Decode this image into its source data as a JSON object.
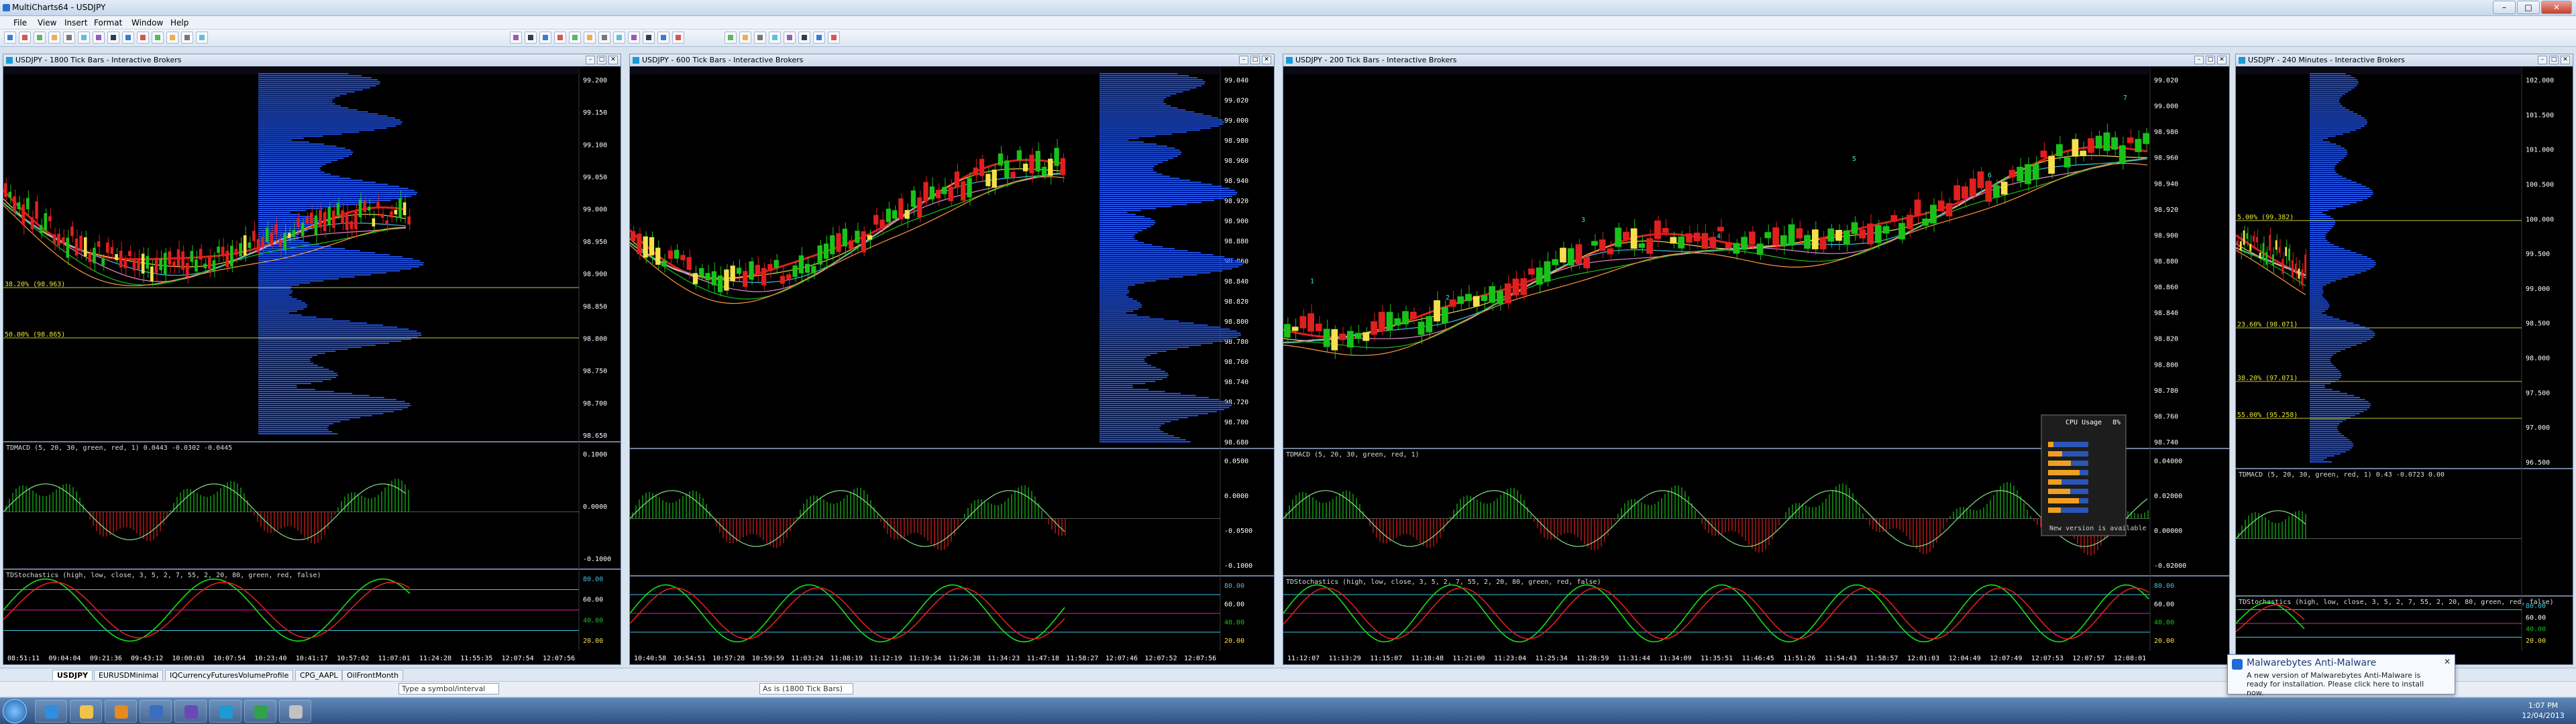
{
  "app": {
    "title": "MultiCharts64 - USDJPY",
    "menu": [
      "File",
      "View",
      "Insert",
      "Format",
      "Window",
      "Help"
    ]
  },
  "windows": [
    {
      "title": "USDJPY - 1800 Tick Bars - Interactive Brokers",
      "price_labels": [
        "99.200",
        "99.150",
        "99.100",
        "99.050",
        "99.000",
        "98.950",
        "98.900",
        "98.850",
        "98.800",
        "98.750",
        "98.700",
        "98.650"
      ],
      "fib_labels": [
        "38.20% (98.963)",
        "50.00% (98.865)"
      ],
      "macd_label": "TDMACD (5, 20, 30, green, red, 1)  0.0443 -0.0302 -0.0445",
      "macd_ticks": [
        "0.1000",
        "0.0000",
        "-0.1000"
      ],
      "stoch_label": "TDStochastics (high, low, close, 3, 5, 2, 7, 55, 2, 20, 80, green, red, false)",
      "stoch_ticks": [
        "80.00",
        "60.00",
        "40.00",
        "20.00"
      ],
      "time_labels": [
        "08:51:11",
        "09:04:04",
        "09:21:36",
        "09:43:12",
        "10:00:03",
        "10:07:54",
        "10:23:40",
        "10:41:17",
        "10:57:02",
        "11:07:01",
        "11:24:28",
        "11:55:35",
        "12:07:54",
        "12:07:56"
      ]
    },
    {
      "title": "USDJPY - 600 Tick Bars - Interactive Brokers",
      "price_labels": [
        "99.040",
        "99.020",
        "99.000",
        "98.980",
        "98.960",
        "98.940",
        "98.920",
        "98.900",
        "98.880",
        "98.860",
        "98.840",
        "98.820",
        "98.800",
        "98.780",
        "98.760",
        "98.740",
        "98.720",
        "98.700",
        "98.680"
      ],
      "macd_label": "",
      "macd_ticks": [
        "0.0500",
        "0.0000",
        "-0.0500",
        "-0.1000"
      ],
      "stoch_label": "",
      "stoch_ticks": [
        "80.00",
        "60.00",
        "40.00",
        "20.00"
      ],
      "time_labels": [
        "10:40:58",
        "10:54:51",
        "10:57:28",
        "10:59:59",
        "11:03:24",
        "11:08:19",
        "11:12:19",
        "11:19:34",
        "11:26:38",
        "11:34:23",
        "11:47:18",
        "11:58:27",
        "12:07:46",
        "12:07:52",
        "12:07:56"
      ]
    },
    {
      "title": "USDJPY - 200 Tick Bars - Interactive Brokers",
      "price_labels": [
        "99.020",
        "99.000",
        "98.980",
        "98.960",
        "98.940",
        "98.920",
        "98.900",
        "98.880",
        "98.860",
        "98.840",
        "98.820",
        "98.800",
        "98.780",
        "98.760",
        "98.740"
      ],
      "wave_labels": [
        "1",
        "2",
        "3",
        "4",
        "5",
        "6",
        "7"
      ],
      "macd_label": "TDMACD (5, 20, 30, green, red, 1)",
      "macd_ticks": [
        "0.04000",
        "0.02000",
        "0.00000",
        "-0.02000"
      ],
      "stoch_label": "TDStochastics (high, low, close, 3, 5, 2, 7, 55, 2, 20, 80, green, red, false)",
      "stoch_ticks": [
        "80.00",
        "60.00",
        "40.00",
        "20.00"
      ],
      "time_labels": [
        "11:12:07",
        "11:13:29",
        "11:15:07",
        "11:18:48",
        "11:21:00",
        "11:23:04",
        "11:25:34",
        "11:28:59",
        "11:31:44",
        "11:34:09",
        "11:35:51",
        "11:46:45",
        "11:51:26",
        "11:54:43",
        "11:58:57",
        "12:01:03",
        "12:04:49",
        "12:07:49",
        "12:07:53",
        "12:07:57",
        "12:08:01"
      ],
      "cpu_widget": {
        "title": "CPU Usage",
        "value": "8%",
        "footer": "New version is available"
      }
    },
    {
      "title": "USDJPY - 240 Minutes - Interactive Brokers",
      "price_labels": [
        "102.000",
        "101.500",
        "101.000",
        "100.500",
        "100.000",
        "99.500",
        "99.000",
        "98.500",
        "98.000",
        "97.500",
        "97.000",
        "96.500"
      ],
      "fib_labels": [
        "5.00% (99.382)",
        "23.60% (98.071)",
        "38.20% (97.071)",
        "55.00% (95.258)"
      ],
      "macd_label": "TDMACD (5, 20, 30, green, red, 1)  0.43 -0.0723  0.00",
      "stoch_label": "TDStochastics (high, low, close, 3, 5, 2, 7, 55, 2, 20, 80, green, red, false)",
      "stoch_ticks": [
        "80.00",
        "60.00",
        "40.00",
        "20.00"
      ]
    }
  ],
  "workspace_tabs": [
    "USDJPY",
    "EURUSDMinimal",
    "IQCurrencyFuturesVolumeProfile",
    "CPG_AAPL",
    "OilFrontMonth"
  ],
  "symbol_field": "Type a symbol/interval",
  "bottom_field": "As is (1800 Tick Bars)",
  "notification": {
    "title": "Malwarebytes Anti-Malware",
    "message": "A new version of Malwarebytes Anti-Malware is ready for installation. Please click here to install now."
  },
  "clock": {
    "time": "1:07 PM",
    "date": "12/04/2013"
  },
  "colors": {
    "bg": "#000000",
    "bull": "#19c219",
    "bear": "#e01f1f",
    "accent": "#1f6bd8"
  }
}
